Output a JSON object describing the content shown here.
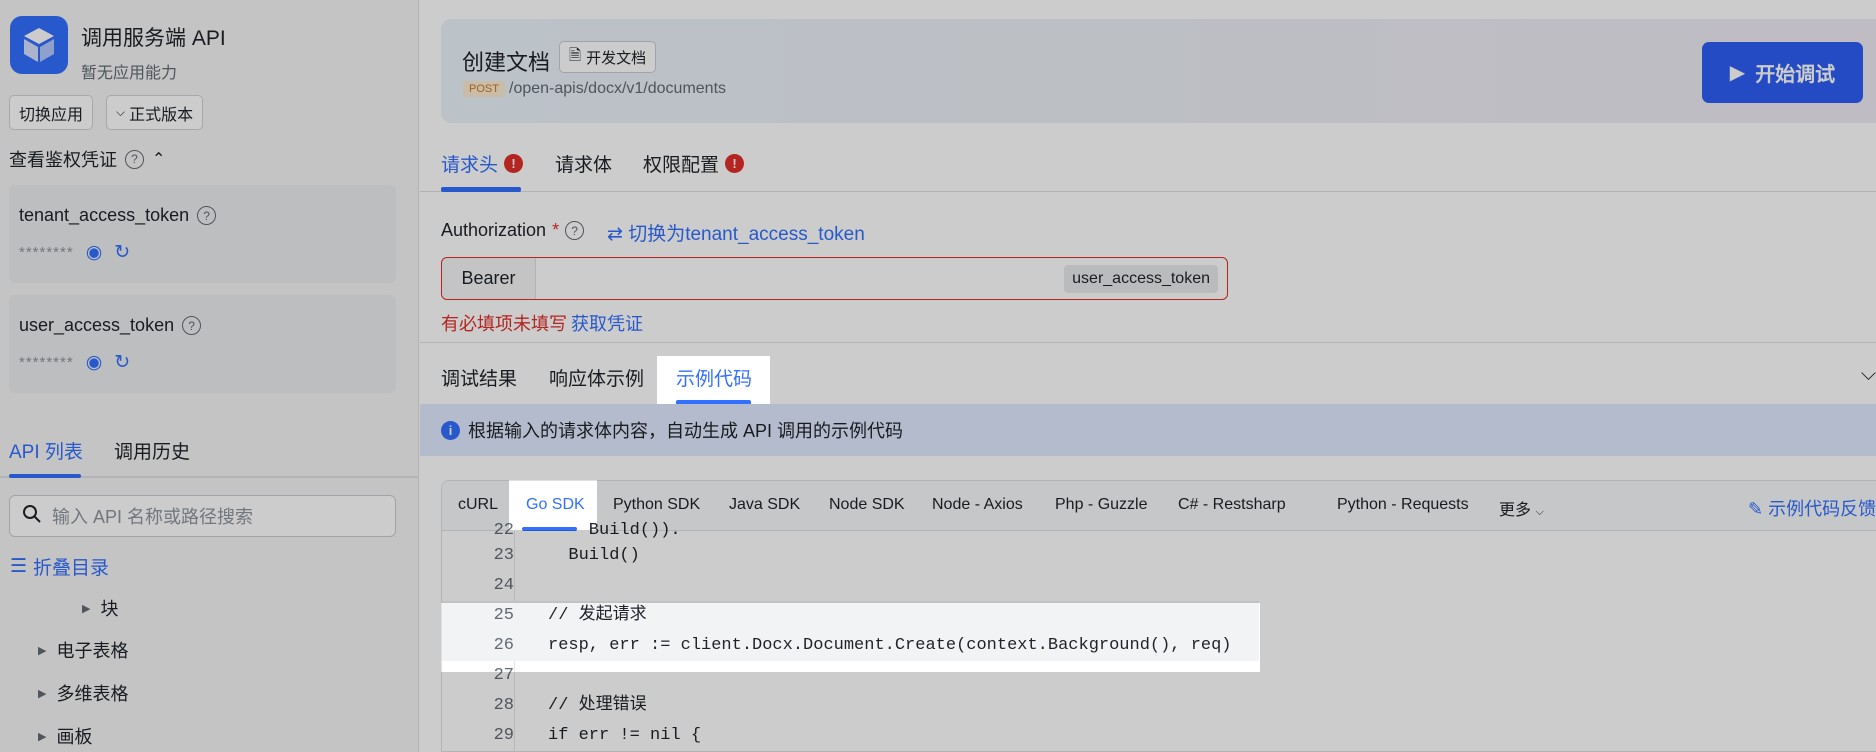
{
  "sidebar": {
    "app_title": "调用服务端 API",
    "app_subtitle": "暂无应用能力",
    "switch_app_label": "切换应用",
    "version_label": "正式版本",
    "credentials_label": "查看鉴权凭证",
    "tokens": [
      {
        "name": "tenant_access_token",
        "masked": "********"
      },
      {
        "name": "user_access_token",
        "masked": "********"
      }
    ],
    "tabs": [
      {
        "label": "API 列表"
      },
      {
        "label": "调用历史"
      }
    ],
    "search_placeholder": "输入 API 名称或路径搜索",
    "collapse_label": "折叠目录",
    "tree_items": [
      {
        "label": "块"
      },
      {
        "label": "电子表格"
      },
      {
        "label": "多维表格"
      },
      {
        "label": "画板"
      }
    ]
  },
  "header": {
    "title": "创建文档",
    "dev_doc_label": "开发文档",
    "method": "POST",
    "endpoint": "/open-apis/docx/v1/documents",
    "start_label": "开始调试"
  },
  "request_tabs": [
    {
      "label": "请求头"
    },
    {
      "label": "请求体"
    },
    {
      "label": "权限配置"
    }
  ],
  "auth": {
    "label": "Authorization",
    "switch_label": "切换为tenant_access_token",
    "bearer": "Bearer",
    "token_chip": "user_access_token",
    "error_text": "有必填项未填写",
    "get_credential": "获取凭证"
  },
  "response_tabs": [
    {
      "label": "调试结果"
    },
    {
      "label": "响应体示例"
    },
    {
      "label": "示例代码"
    }
  ],
  "info_text": "根据输入的请求体内容，自动生成 API 调用的示例代码",
  "sdk_tabs": [
    {
      "label": "cURL"
    },
    {
      "label": "Go SDK"
    },
    {
      "label": "Python SDK"
    },
    {
      "label": "Java SDK"
    },
    {
      "label": "Node SDK"
    },
    {
      "label": "Node - Axios"
    },
    {
      "label": "Php - Guzzle"
    },
    {
      "label": "C# - Restsharp"
    },
    {
      "label": "Python - Requests"
    }
  ],
  "sdk_more": "更多",
  "feedback_label": "示例代码反馈",
  "code": {
    "lines": [
      {
        "num": "22",
        "text": "    Build())."
      },
      {
        "num": "23",
        "text": "  Build()"
      },
      {
        "num": "24",
        "text": ""
      },
      {
        "num": "25",
        "text": "// 发起请求"
      },
      {
        "num": "26",
        "text": "resp, err := client.Docx.Document.Create(context.Background(), req)"
      },
      {
        "num": "27",
        "text": ""
      },
      {
        "num": "28",
        "text": "// 处理错误"
      },
      {
        "num": "29",
        "text": "if err != nil {"
      }
    ]
  },
  "colors": {
    "accent": "#3370ff",
    "error": "#e22e28",
    "start_button": "#2d5ef5"
  }
}
